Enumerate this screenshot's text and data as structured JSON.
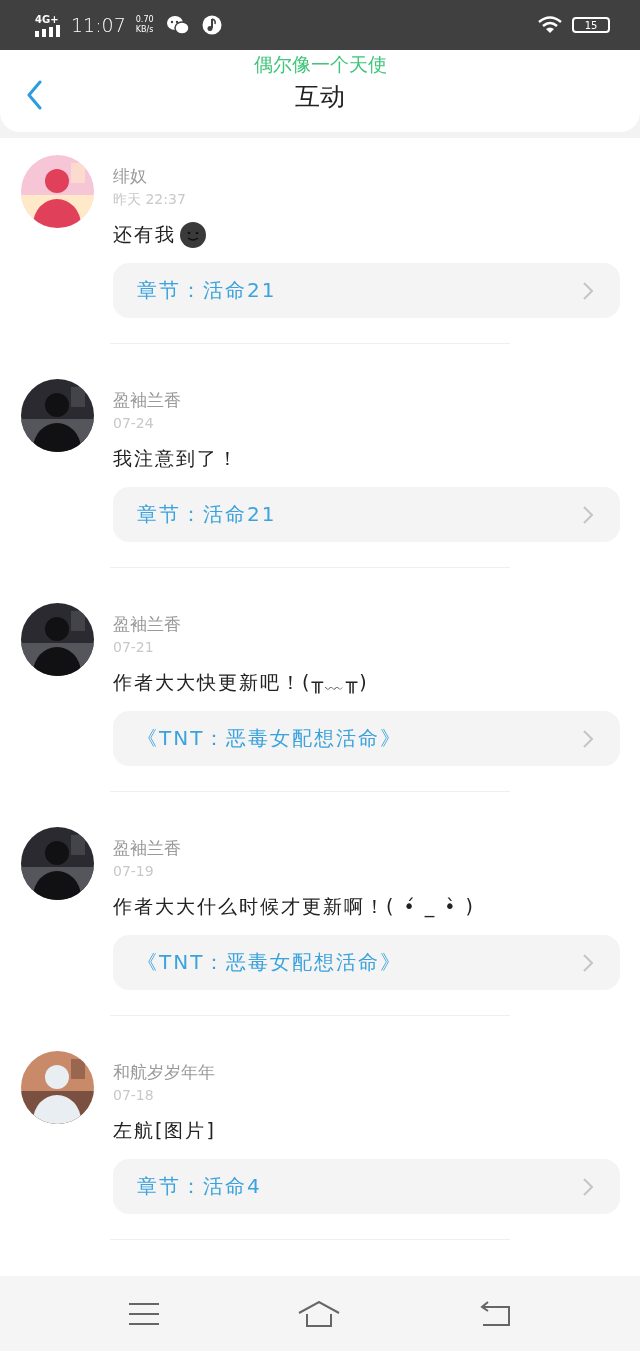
{
  "status_bar": {
    "network": "4G+",
    "time": "11:07",
    "speed": "0.70",
    "speed_unit": "KB/s",
    "battery": "15"
  },
  "header": {
    "lyric": "偶尔像一个天使",
    "title": "互动"
  },
  "comments": [
    {
      "name": "绯奴",
      "time": "昨天  22:37",
      "message": "还有我",
      "trailing_icon": true,
      "link": "章节：活命21"
    },
    {
      "name": "盈袖兰香",
      "time": "07-24",
      "message": "我注意到了！",
      "trailing_icon": false,
      "link": "章节：活命21"
    },
    {
      "name": "盈袖兰香",
      "time": "07-21",
      "message": "作者大大快更新吧！(╥﹏╥)",
      "trailing_icon": false,
      "link": "《TNT：恶毒女配想活命》"
    },
    {
      "name": "盈袖兰香",
      "time": "07-19",
      "message": "作者大大什么时候才更新啊！( •́ _ •̀ )",
      "trailing_icon": false,
      "link": "《TNT：恶毒女配想活命》"
    },
    {
      "name": "和航岁岁年年",
      "time": "07-18",
      "message": "左航[图片]",
      "trailing_icon": false,
      "link": "章节：活命4"
    }
  ]
}
